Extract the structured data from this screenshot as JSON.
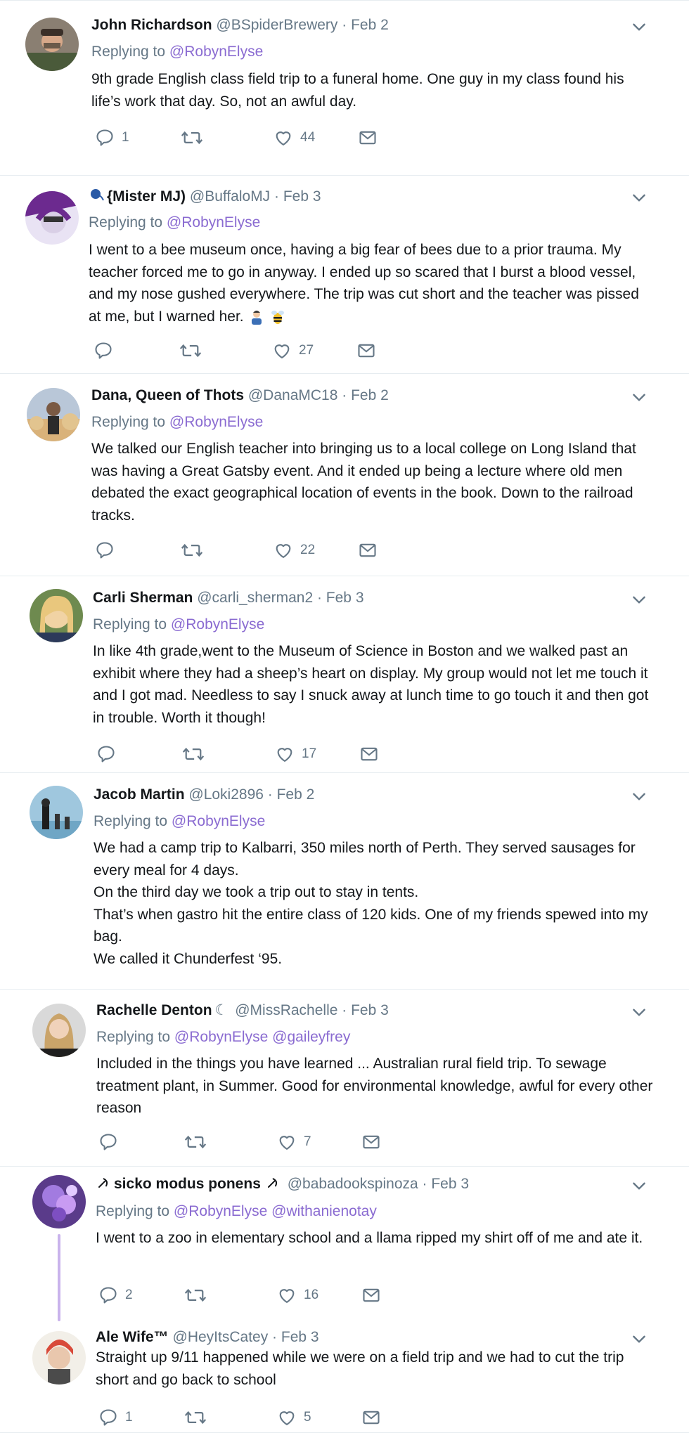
{
  "tweets": [
    {
      "name": "John Richardson",
      "handle": "@BSpiderBrewery",
      "date": "Feb 2",
      "replying_label": "Replying to",
      "mentions": [
        "@RobynElyse"
      ],
      "text": [
        "9th grade English class field trip to a funeral home. One guy in my class found his life’s work that day. So, not an awful day."
      ],
      "counts": {
        "reply": "1",
        "retweet": "",
        "like": "44"
      }
    },
    {
      "name": "{Mister MJ)",
      "handle": "@BuffaloMJ",
      "date": "Feb 3",
      "replying_label": "Replying to",
      "mentions": [
        "@RobynElyse"
      ],
      "text": [
        "I went to a bee museum once, having a big fear of bees due to a prior trauma. My teacher forced me to go in anyway. I ended up so scared that I burst a blood vessel, and my nose gushed everywhere. The trip was cut short and the teacher was pissed at me, but I warned her."
      ],
      "counts": {
        "reply": "",
        "retweet": "",
        "like": "27"
      }
    },
    {
      "name": "Dana, Queen of Thots",
      "handle": "@DanaMC18",
      "date": "Feb 2",
      "replying_label": "Replying to",
      "mentions": [
        "@RobynElyse"
      ],
      "text": [
        "We talked our English teacher into bringing us to a local college on Long Island that was having a Great Gatsby event. And it ended up being a lecture where old men debated the exact geographical location of events in the book. Down to the railroad tracks."
      ],
      "counts": {
        "reply": "",
        "retweet": "",
        "like": "22"
      }
    },
    {
      "name": "Carli Sherman",
      "handle": "@carli_sherman2",
      "date": "Feb 3",
      "replying_label": "Replying to",
      "mentions": [
        "@RobynElyse"
      ],
      "text": [
        "In like 4th grade,went to the Museum of Science in Boston and we walked past an exhibit where they had a sheep’s heart on display. My group would not let me touch it and I got mad. Needless to say I snuck away at lunch time to go touch it and then got in trouble. Worth it though!"
      ],
      "counts": {
        "reply": "",
        "retweet": "",
        "like": "17"
      }
    },
    {
      "name": "Jacob Martin",
      "handle": "@Loki2896",
      "date": "Feb 2",
      "replying_label": "Replying to",
      "mentions": [
        "@RobynElyse"
      ],
      "text": [
        "We had a camp trip to Kalbarri, 350 miles north of Perth. They served sausages for every meal for 4 days.",
        "On the third day we took a trip out to stay in tents.",
        "That’s when gastro hit the entire class of 120 kids. One of my friends spewed into my bag.",
        "We called it Chunderfest ‘95."
      ],
      "counts": {
        "reply": "",
        "retweet": "",
        "like": ""
      }
    },
    {
      "name": "Rachelle Denton",
      "handle": "@MissRachelle",
      "date": "Feb 3",
      "replying_label": "Replying to",
      "mentions": [
        "@RobynElyse",
        "@gaileyfrey"
      ],
      "text": [
        "Included in the things you have learned ... Australian rural field trip. To sewage treatment plant, in Summer. Good for environmental knowledge, awful for every other reason"
      ],
      "counts": {
        "reply": "",
        "retweet": "",
        "like": "7"
      }
    },
    {
      "name": "sicko modus ponens",
      "handle": "@babadookspinoza",
      "date": "Feb 3",
      "replying_label": "Replying to",
      "mentions": [
        "@RobynElyse",
        "@withanienotay"
      ],
      "text": [
        "I went to a zoo in elementary school and a llama ripped my shirt off of me and ate it."
      ],
      "counts": {
        "reply": "2",
        "retweet": "",
        "like": "16"
      }
    },
    {
      "name": "Ale Wife™",
      "handle": "@HeyItsCatey",
      "date": "Feb 3",
      "replying_label": "",
      "mentions": [],
      "text": [
        "Straight up 9/11 happened while we were on a field trip and we had to cut the trip short and go back to school"
      ],
      "counts": {
        "reply": "1",
        "retweet": "",
        "like": "5"
      }
    }
  ],
  "colors": {
    "name": "#14171a",
    "muted": "#657786",
    "mention": "#8a6bd1",
    "divider": "#e6ecf0",
    "thread": "#c9b3ec"
  },
  "icons": {
    "reply": "reply-icon",
    "retweet": "retweet-icon",
    "like": "heart-icon",
    "dm": "envelope-icon",
    "menu": "chevron-down-icon"
  }
}
